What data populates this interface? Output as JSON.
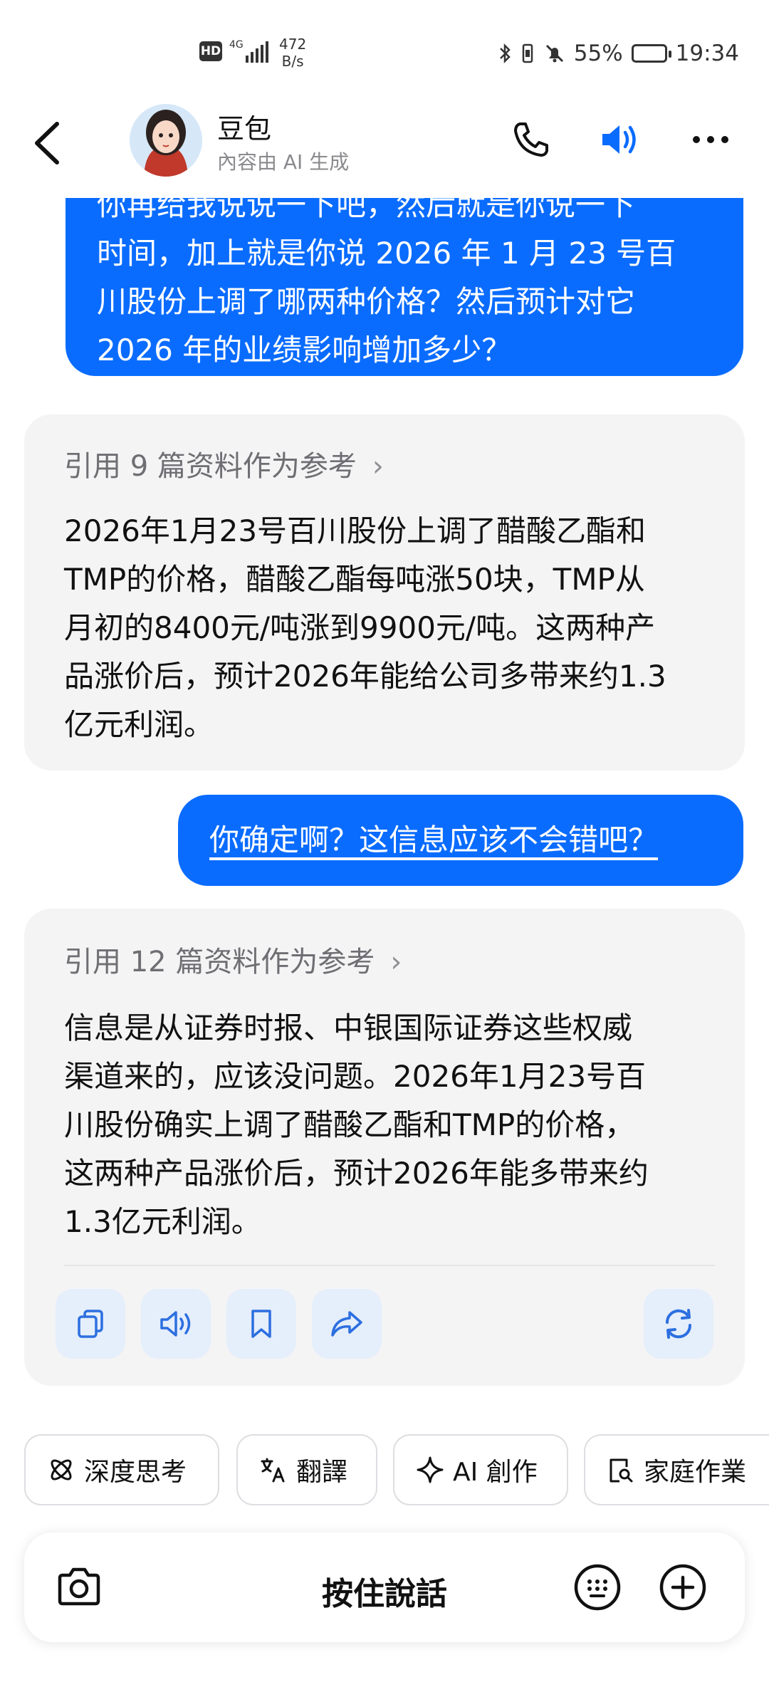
{
  "status_bar": {
    "hd": "HD",
    "network": "4G",
    "rate_value": "472",
    "rate_unit": "B/s",
    "battery": "55%",
    "time": "19:34"
  },
  "header": {
    "name": "豆包",
    "subtitle": "內容由 AI 生成"
  },
  "messages": {
    "user1_lines": [
      "你再给我说说一下吧，然后就是你说一下",
      "时间，加上就是你说 2026 年 1 月 23 号百",
      "川股份上调了哪两种价格？然后预计对它",
      "2026 年的业绩影响增加多少？"
    ],
    "ai1_ref": "引用 9 篇资料作为参考",
    "ai1_lines": [
      "2026年1月23号百川股份上调了醋酸乙酯和",
      "TMP的价格，醋酸乙酯每吨涨50块，TMP从",
      "月初的8400元/吨涨到9900元/吨。这两种产",
      "品涨价后，预计2026年能给公司多带来约1.3",
      "亿元利润。"
    ],
    "user2": "你确定啊？这信息应该不会错吧？",
    "ai2_ref": "引用 12 篇资料作为参考",
    "ai2_lines": [
      "信息是从证券时报、中银国际证券这些权威",
      "渠道来的，应该没问题。2026年1月23号百",
      "川股份确实上调了醋酸乙酯和TMP的价格，",
      "这两种产品涨价后，预计2026年能多带来约",
      "1.3亿元利润。"
    ]
  },
  "chips": [
    "深度思考",
    "翻譯",
    "AI 創作",
    "家庭作業"
  ],
  "input": {
    "hold_to_talk": "按住說話"
  },
  "colors": {
    "accent": "#0a6cff",
    "ai_bubble": "#f4f4f5",
    "action_bg": "#e5eefb"
  }
}
